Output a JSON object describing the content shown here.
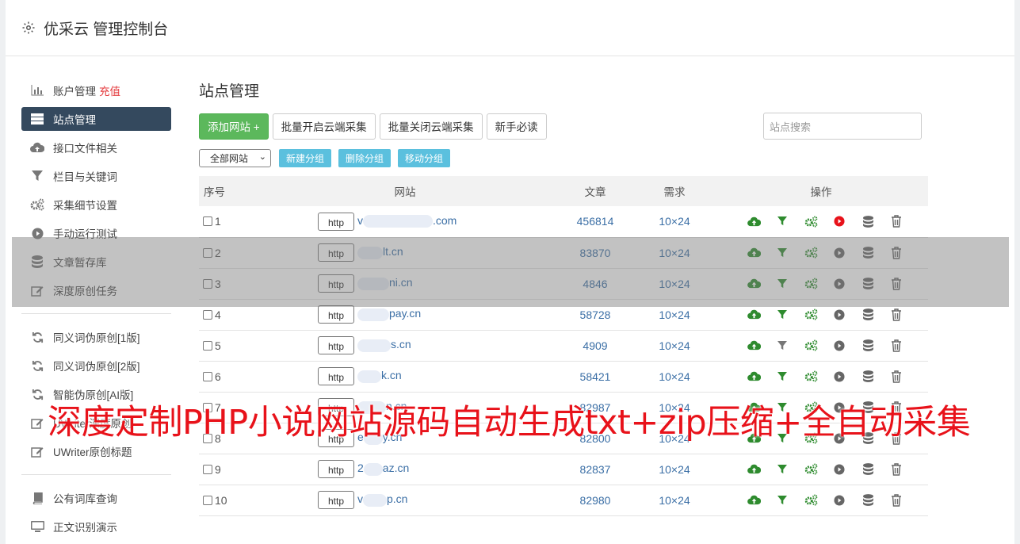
{
  "app": {
    "title": "优采云 管理控制台"
  },
  "sidebar": {
    "items": [
      {
        "label": "账户管理",
        "extra": "充值",
        "icon": "bar-chart-icon"
      },
      {
        "label": "站点管理",
        "icon": "server-icon",
        "active": true
      },
      {
        "label": "接口文件相关",
        "icon": "cloud-upload-icon"
      },
      {
        "label": "栏目与关键词",
        "icon": "filter-icon"
      },
      {
        "label": "采集细节设置",
        "icon": "cogs-icon"
      },
      {
        "label": "手动运行测试",
        "icon": "play-icon"
      },
      {
        "label": "文章暂存库",
        "icon": "database-icon"
      },
      {
        "label": "深度原创任务",
        "icon": "edit-icon"
      },
      {
        "label": "同义词伪原创[1版]",
        "icon": "refresh-icon"
      },
      {
        "label": "同义词伪原创[2版]",
        "icon": "refresh-icon"
      },
      {
        "label": "智能伪原创[AI版]",
        "icon": "refresh-icon"
      },
      {
        "label": "UWriter深度原创",
        "icon": "edit-icon"
      },
      {
        "label": "UWriter原创标题",
        "icon": "edit-icon"
      },
      {
        "label": "公有词库查询",
        "icon": "book-icon"
      },
      {
        "label": "正文识别演示",
        "icon": "monitor-icon"
      }
    ]
  },
  "main": {
    "title": "站点管理",
    "toolbar": {
      "add_site": "添加网站 +",
      "batch_enable": "批量开启云端采集",
      "batch_disable": "批量关闭云端采集",
      "newbie": "新手必读",
      "search_placeholder": "站点搜索"
    },
    "group_select": "全部网站",
    "group_buttons": {
      "new": "新建分组",
      "delete": "删除分组",
      "move": "移动分组"
    },
    "table": {
      "headers": {
        "idx": "序号",
        "site": "网站",
        "articles": "文章",
        "demand": "需求",
        "ops": "操作"
      },
      "protocol_label": "http",
      "rows": [
        {
          "idx": "1",
          "site_prefix": "v",
          "site_suffix": ".com",
          "articles": "456814",
          "demand": "10×24"
        },
        {
          "idx": "2",
          "site_prefix": "",
          "site_suffix": "lt.cn",
          "articles": "83870",
          "demand": "10×24"
        },
        {
          "idx": "3",
          "site_prefix": "",
          "site_suffix": "ni.cn",
          "articles": "4846",
          "demand": "10×24"
        },
        {
          "idx": "4",
          "site_prefix": "",
          "site_suffix": "pay.cn",
          "articles": "58728",
          "demand": "10×24"
        },
        {
          "idx": "5",
          "site_prefix": "",
          "site_suffix": "s.cn",
          "articles": "4909",
          "demand": "10×24"
        },
        {
          "idx": "6",
          "site_prefix": "",
          "site_suffix": "k.cn",
          "articles": "58421",
          "demand": "10×24"
        },
        {
          "idx": "7",
          "site_prefix": "",
          "site_suffix": "n.cn",
          "articles": "82987",
          "demand": "10×24"
        },
        {
          "idx": "8",
          "site_prefix": "e",
          "site_suffix": "y.cn",
          "articles": "82800",
          "demand": "10×24"
        },
        {
          "idx": "9",
          "site_prefix": "2",
          "site_suffix": "az.cn",
          "articles": "82837",
          "demand": "10×24"
        },
        {
          "idx": "10",
          "site_prefix": "v",
          "site_suffix": "p.cn",
          "articles": "82980",
          "demand": "10×24"
        }
      ]
    }
  },
  "banner": "深度定制PHP小说网站源码自动生成txt+zip压缩+全自动采集",
  "colors": {
    "active_nav": "#34495e",
    "add_button": "#5cb85c",
    "group_button": "#5bc0de",
    "banner": "#e8121a",
    "link": "#3a6ea5"
  }
}
